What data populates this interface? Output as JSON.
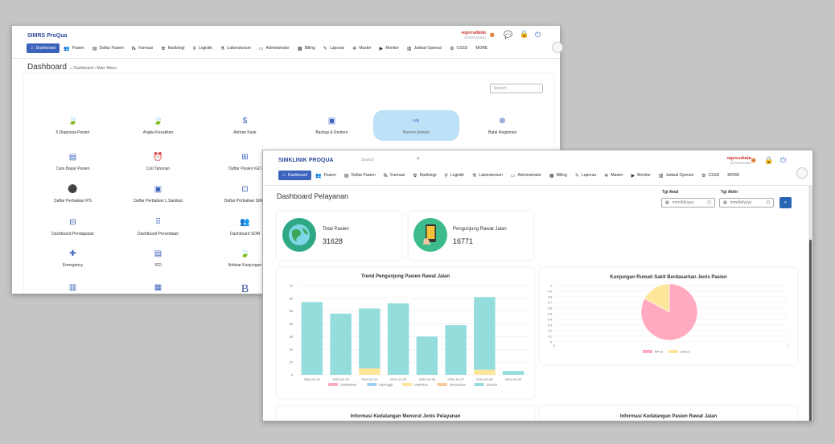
{
  "back_window": {
    "brand": "SIMRS ProQua",
    "user": {
      "name": "superadmin",
      "role": "SUPERADMIN"
    },
    "menu": [
      {
        "icon": "⌂",
        "label": "Dashboard",
        "active": true
      },
      {
        "icon": "👥",
        "label": "Pasien"
      },
      {
        "icon": "▤",
        "label": "Daftar Pasien"
      },
      {
        "icon": "℞",
        "label": "Farmasi"
      },
      {
        "icon": "☢",
        "label": "Radiologi"
      },
      {
        "icon": "⚲",
        "label": "Logistik"
      },
      {
        "icon": "⚗",
        "label": "Laboratorium"
      },
      {
        "icon": "▭",
        "label": "Administrator"
      },
      {
        "icon": "▦",
        "label": "Billing"
      },
      {
        "icon": "✎",
        "label": "Laporan"
      },
      {
        "icon": "✲",
        "label": "Master"
      },
      {
        "icon": "▶",
        "label": "Monitor"
      },
      {
        "icon": "▥",
        "label": "Jadwal Operasi"
      },
      {
        "icon": "⚙",
        "label": "CSSD"
      },
      {
        "icon": "",
        "label": "MORE"
      }
    ],
    "page_title": "Dashboard",
    "breadcrumb": "Dashboard  ›  Main Menu",
    "search_placeholder": "Search",
    "tiles": [
      {
        "icon": "🍃",
        "label": "5 Diagnosa Pasien"
      },
      {
        "icon": "🍃",
        "label": "Angka Kesakitan"
      },
      {
        "icon": "$",
        "label": "Antrian Kasir"
      },
      {
        "icon": "▣",
        "label": "Backup & Restore"
      },
      {
        "icon": "⇨",
        "label": "Banner Antrian"
      },
      {
        "icon": "⊗",
        "label": "Batal Registrasi"
      },
      {
        "icon": "▤",
        "label": "Cara Bayar Pasien"
      },
      {
        "icon": "⏰",
        "label": "Cuti Tahunan"
      },
      {
        "icon": "⊞",
        "label": "Daftar Pasien IGD"
      },
      {
        "icon": "",
        "label": ""
      },
      {
        "icon": "",
        "label": ""
      },
      {
        "icon": "",
        "label": ""
      },
      {
        "icon": "⚫",
        "label": "Daftar Perbaikan IPS"
      },
      {
        "icon": "▣",
        "label": "Daftar Perbaikan L.Sanitasi"
      },
      {
        "icon": "⊡",
        "label": "Daftar Perbaikan SIMR"
      },
      {
        "icon": "",
        "label": ""
      },
      {
        "icon": "",
        "label": ""
      },
      {
        "icon": "",
        "label": ""
      },
      {
        "icon": "⊟",
        "label": "Dashboard Pendapatan"
      },
      {
        "icon": "⠿",
        "label": "Dashboard Persediaan"
      },
      {
        "icon": "👥",
        "label": "Dashboard SDM"
      },
      {
        "icon": "",
        "label": ""
      },
      {
        "icon": "",
        "label": ""
      },
      {
        "icon": "",
        "label": ""
      },
      {
        "icon": "✚",
        "label": "Emergency"
      },
      {
        "icon": "▤",
        "label": "ICD"
      },
      {
        "icon": "🍃",
        "label": "Ikhtisar Kunjungan"
      },
      {
        "icon": "",
        "label": ""
      },
      {
        "icon": "",
        "label": ""
      },
      {
        "icon": "",
        "label": ""
      },
      {
        "icon": "▥",
        "label": ""
      },
      {
        "icon": "▦",
        "label": ""
      },
      {
        "icon": "B",
        "label": ""
      }
    ]
  },
  "front_window": {
    "brand": "SIMKLINIK PROQUA",
    "search_placeholder": "Search",
    "user": {
      "name": "superadmin",
      "role": "SUPERADMIN"
    },
    "menu": [
      {
        "icon": "⌂",
        "label": "Dashboard",
        "active": true
      },
      {
        "icon": "👥",
        "label": "Pasien"
      },
      {
        "icon": "▤",
        "label": "Daftar Pasien"
      },
      {
        "icon": "℞",
        "label": "Farmasi"
      },
      {
        "icon": "☢",
        "label": "Radiologi"
      },
      {
        "icon": "⚲",
        "label": "Logistik"
      },
      {
        "icon": "⚗",
        "label": "Laboratorium"
      },
      {
        "icon": "▭",
        "label": "Administrator"
      },
      {
        "icon": "▦",
        "label": "Billing"
      },
      {
        "icon": "✎",
        "label": "Laporan"
      },
      {
        "icon": "✲",
        "label": "Master"
      },
      {
        "icon": "▶",
        "label": "Monitor"
      },
      {
        "icon": "▥",
        "label": "Jadwal Operasi"
      },
      {
        "icon": "⚙",
        "label": "CSSD"
      },
      {
        "icon": "",
        "label": "MORE"
      }
    ],
    "page_title": "Dashboard Pelayanan",
    "filters": {
      "start_label": "Tgl Awal",
      "end_label": "Tgl Akhir",
      "start_placeholder": "mm/dd/yyyy",
      "end_placeholder": "mm/dd/yyyy"
    },
    "stats": [
      {
        "label": "Total Pasien",
        "value": "31628",
        "color": "#2fa886"
      },
      {
        "label": "Pengunjung Rawat Jalan",
        "value": "16771",
        "color": "#3dbb8a"
      }
    ],
    "bottom_titles": [
      "Informasi Kedatangan Menurut Jenis Pelayanan",
      "Informasi Kedatangan Pasien Rawat Jalan"
    ]
  },
  "colors": {
    "accent": "#3c63bb",
    "teal": "#95dcdc",
    "yellow": "#fde59a",
    "pink": "#ffaabf"
  },
  "chart_data": [
    {
      "type": "bar",
      "title": "Trend Pengunjung Pasien Rawat Jalan",
      "categories": [
        "2024-10-22",
        "2024-10-23",
        "2024-10-24",
        "2024-10-25",
        "2024-10-26",
        "2024-10-27",
        "2024-10-28",
        "2024-10-29"
      ],
      "ylim": [
        0,
        70
      ],
      "yticks": [
        0,
        10,
        20,
        30,
        40,
        50,
        60,
        70
      ],
      "stacked": true,
      "series": [
        {
          "name": "Didaftarkan",
          "color": "#ffaabf",
          "values": [
            0,
            0,
            0,
            0,
            0,
            0,
            0,
            0
          ]
        },
        {
          "name": "Dipanggil",
          "color": "#9ccff2",
          "values": [
            0,
            0,
            0,
            0,
            0,
            0,
            0,
            0
          ]
        },
        {
          "name": "Diperiksa",
          "color": "#fde59a",
          "values": [
            0,
            0,
            5,
            0,
            0,
            0,
            4,
            0
          ]
        },
        {
          "name": "Diresepkan",
          "color": "#f8c99b",
          "values": [
            0,
            0,
            0,
            0,
            0,
            0,
            0,
            0
          ]
        },
        {
          "name": "Selesai",
          "color": "#95dcdc",
          "values": [
            57,
            48,
            47,
            56,
            30,
            39,
            57,
            3
          ]
        }
      ]
    },
    {
      "type": "pie",
      "title": "Kunjungan Rumah Sakit Berdasarkan Jenis Pasien",
      "labels": [
        "BPJS",
        "Umum"
      ],
      "values": [
        83,
        17
      ],
      "colors": [
        "#ffaabf",
        "#fde59a"
      ],
      "yticks": [
        "1",
        "0.9",
        "0.8",
        "0.7",
        "0.6",
        "0.5",
        "0.4",
        "0.3",
        "0.2",
        "0.1",
        "0"
      ],
      "xticks": [
        "0",
        "1"
      ]
    }
  ]
}
